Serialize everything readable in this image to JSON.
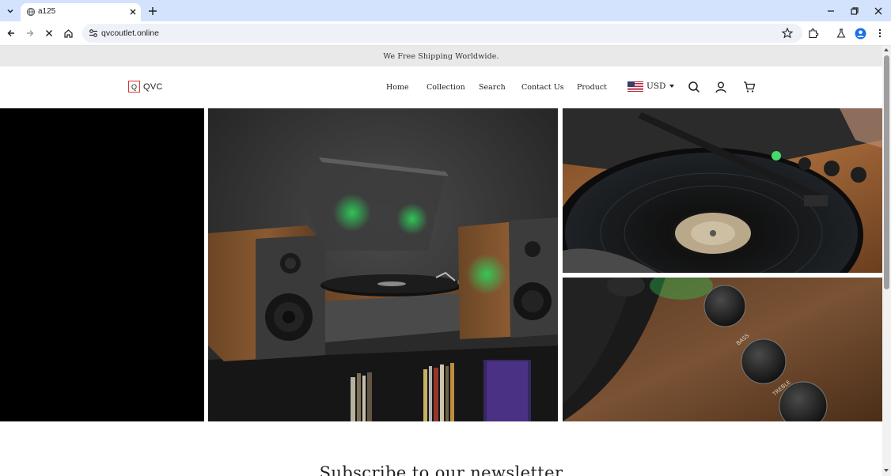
{
  "browser": {
    "tab": {
      "title": "a125"
    },
    "address_bar": {
      "url": "qvcoutlet.online"
    }
  },
  "announcement": {
    "text": "We Free Shipping Worldwide."
  },
  "header": {
    "logo": {
      "mark": "Q",
      "text": "QVC"
    },
    "nav": [
      {
        "label": "Home"
      },
      {
        "label": "Collection"
      },
      {
        "label": "Search"
      },
      {
        "label": "Contact Us"
      },
      {
        "label": "Product"
      }
    ],
    "currency": {
      "code": "USD",
      "flag": "us-flag-icon"
    },
    "icons": [
      "search-icon",
      "account-icon",
      "cart-icon"
    ]
  },
  "gallery": {
    "images": [
      {
        "name": "black-panel"
      },
      {
        "name": "record-player-with-speakers-image"
      },
      {
        "name": "spinning-vinyl-closeup-image"
      },
      {
        "name": "bass-treble-knobs-image",
        "knob_labels": [
          "BASS",
          "TREBLE"
        ]
      }
    ]
  },
  "newsletter": {
    "heading": "Subscribe to our newsletter"
  },
  "colors": {
    "chrome_tabstrip": "#d3e3fd",
    "announcement_bg": "#e9e9e9",
    "logo_accent": "#dd3333",
    "text": "#222222"
  }
}
